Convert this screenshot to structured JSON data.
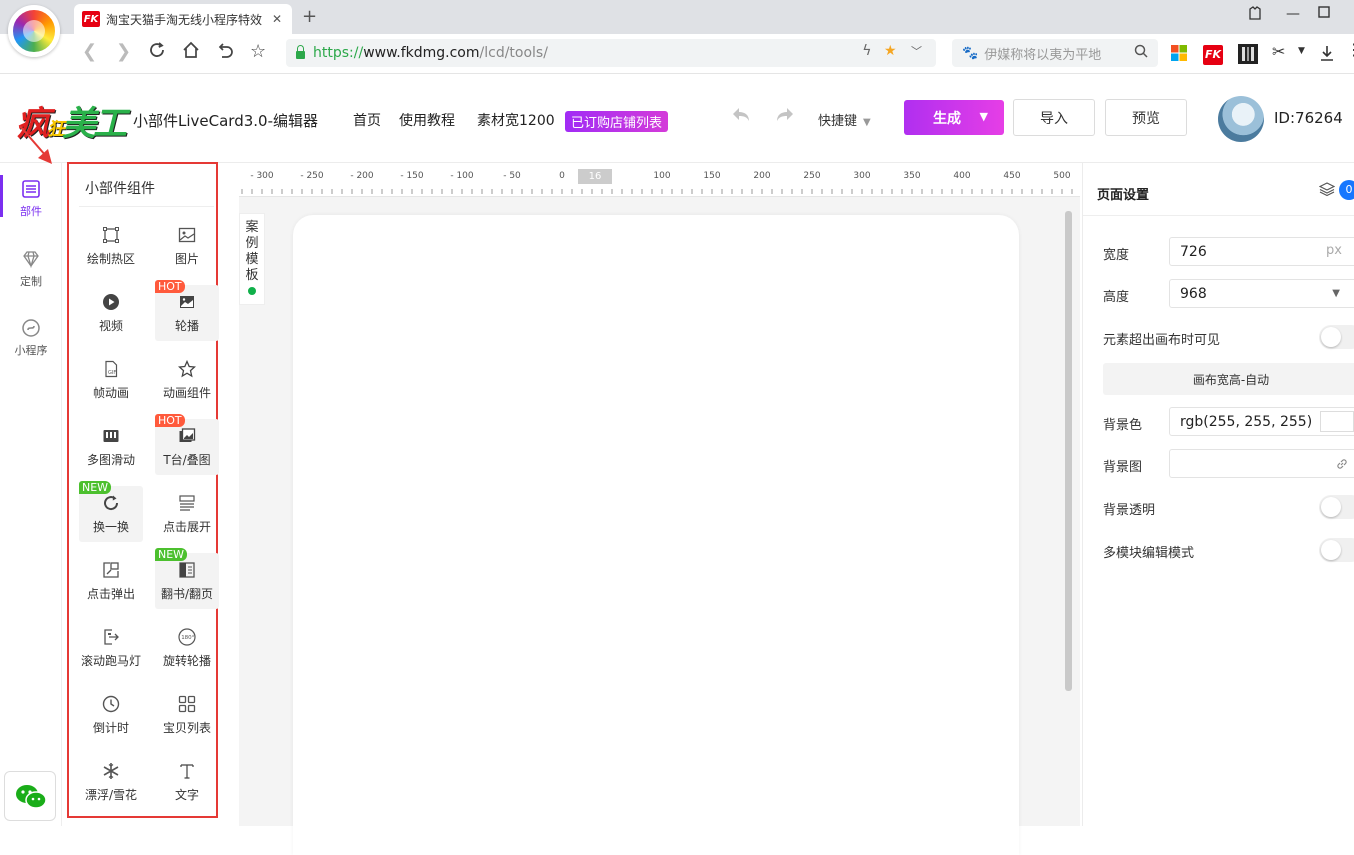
{
  "browser": {
    "tab_title": "淘宝天猫手淘无线小程序特效",
    "fk_text": "FK",
    "new_tab": "+",
    "url_https": "https://",
    "url_host": "www.fkdmg.com",
    "url_path": "/lcd/tools/",
    "search_placeholder": "伊媒称将以夷为平地"
  },
  "header": {
    "logo_text_1": "疯",
    "logo_text_2": "狂",
    "logo_text_3": "美工",
    "app_title": "小部件LiveCard3.0-编辑器",
    "nav": [
      "首页",
      "使用教程",
      "素材宽1200"
    ],
    "shop_badge": "已订购店铺列表",
    "shortcut": "快捷键",
    "generate": "生成",
    "import": "导入",
    "preview": "预览",
    "user_id": "ID:76264"
  },
  "rail": {
    "items": [
      {
        "label": "部件",
        "icon": "layers-icon"
      },
      {
        "label": "定制",
        "icon": "diamond-icon"
      },
      {
        "label": "小程序",
        "icon": "miniprogram-icon"
      }
    ]
  },
  "components": {
    "title": "小部件组件",
    "items": [
      {
        "label": "绘制热区",
        "icon": "hotspot-icon",
        "tag": ""
      },
      {
        "label": "图片",
        "icon": "image-icon",
        "tag": ""
      },
      {
        "label": "视频",
        "icon": "video-icon",
        "tag": ""
      },
      {
        "label": "轮播",
        "icon": "carousel-icon",
        "tag": "HOT"
      },
      {
        "label": "帧动画",
        "icon": "frame-animation-icon",
        "tag": ""
      },
      {
        "label": "动画组件",
        "icon": "star-icon",
        "tag": ""
      },
      {
        "label": "多图滑动",
        "icon": "multi-slide-icon",
        "tag": ""
      },
      {
        "label": "T台/叠图",
        "icon": "stack-images-icon",
        "tag": "HOT"
      },
      {
        "label": "换一换",
        "icon": "refresh-icon",
        "tag": "NEW"
      },
      {
        "label": "点击展开",
        "icon": "expand-icon",
        "tag": ""
      },
      {
        "label": "点击弹出",
        "icon": "popup-icon",
        "tag": ""
      },
      {
        "label": "翻书/翻页",
        "icon": "book-icon",
        "tag": "NEW"
      },
      {
        "label": "滚动跑马灯",
        "icon": "marquee-icon",
        "tag": ""
      },
      {
        "label": "旋转轮播",
        "icon": "rotate-360-icon",
        "tag": ""
      },
      {
        "label": "倒计时",
        "icon": "clock-icon",
        "tag": ""
      },
      {
        "label": "宝贝列表",
        "icon": "grid-list-icon",
        "tag": ""
      },
      {
        "label": "漂浮/雪花",
        "icon": "snowflake-icon",
        "tag": ""
      },
      {
        "label": "文字",
        "icon": "text-icon",
        "tag": ""
      }
    ]
  },
  "ruler": {
    "ticks": [
      "- 300",
      "- 250",
      "- 200",
      "- 150",
      "- 100",
      "- 50",
      "0",
      "100",
      "150",
      "200",
      "250",
      "300",
      "350",
      "400",
      "450",
      "500"
    ],
    "marker": "16"
  },
  "case_tab": {
    "chars": [
      "案",
      "例",
      "模",
      "板"
    ]
  },
  "page_settings": {
    "title": "页面设置",
    "layer_count": "0",
    "width_label": "宽度",
    "width_value": "726",
    "width_unit": "px",
    "height_label": "高度",
    "height_value": "968",
    "overflow_label": "元素超出画布时可见",
    "auto_button": "画布宽高-自动",
    "bgcolor_label": "背景色",
    "bgcolor_value": "rgb(255, 255, 255)",
    "bgimage_label": "背景图",
    "bg_transparent_label": "背景透明",
    "multi_module_label": "多模块编辑模式"
  },
  "colors": {
    "accent": "#7b2ff0",
    "generate_gradient_start": "#b02ff0",
    "generate_gradient_end": "#e63ee6",
    "panel_border": "#e53935",
    "hot_tag": "#ff5a3c",
    "new_tag": "#4cc02e",
    "url_secure": "#2ca84a"
  }
}
